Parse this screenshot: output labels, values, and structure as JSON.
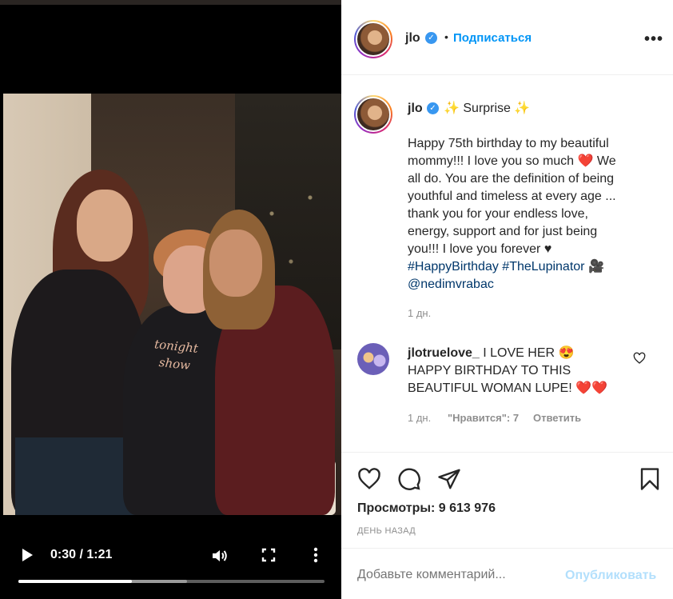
{
  "post": {
    "username": "jlo",
    "follow_label": "Подписаться",
    "more_label": "•••"
  },
  "caption": {
    "username": "jlo",
    "title": "Surprise",
    "text_lines": [
      "Happy 75th birthday to my beautiful",
      "mommy!!! I love you so much",
      "We",
      "all do. You are the definition of being",
      "youthful and timeless at every age ...",
      "thank you for your endless love,",
      "energy, support and for just being",
      "you!!! I love you forever"
    ],
    "hashtag1": "#HappyBirthday",
    "hashtag2": "#TheLupinator",
    "mention": "@nedimvrabac",
    "time": "1 дн."
  },
  "comment": {
    "username": "jlotruelove_",
    "text_part1": "I LOVE HER",
    "text_part2": "HAPPY BIRTHDAY TO THIS BEAUTIFUL WOMAN LUPE!",
    "time": "1 дн.",
    "likes": "\"Нравится\": 7",
    "reply": "Ответить"
  },
  "stats": {
    "views": "Просмотры: 9 613 976",
    "date": "ДЕНЬ НАЗАД"
  },
  "add_comment": {
    "placeholder": "Добавьте комментарий...",
    "post_label": "Опубликовать"
  },
  "video": {
    "time": "0:30 / 1:21",
    "progress": 0.37,
    "buffered": 0.55,
    "shirt_text_line1": "tonight",
    "shirt_text_line2": "show"
  },
  "colors": {
    "accent": "#0095f6",
    "verified": "#3897f0",
    "heart": "#ed4956",
    "post_disabled": "#b2dffc"
  }
}
